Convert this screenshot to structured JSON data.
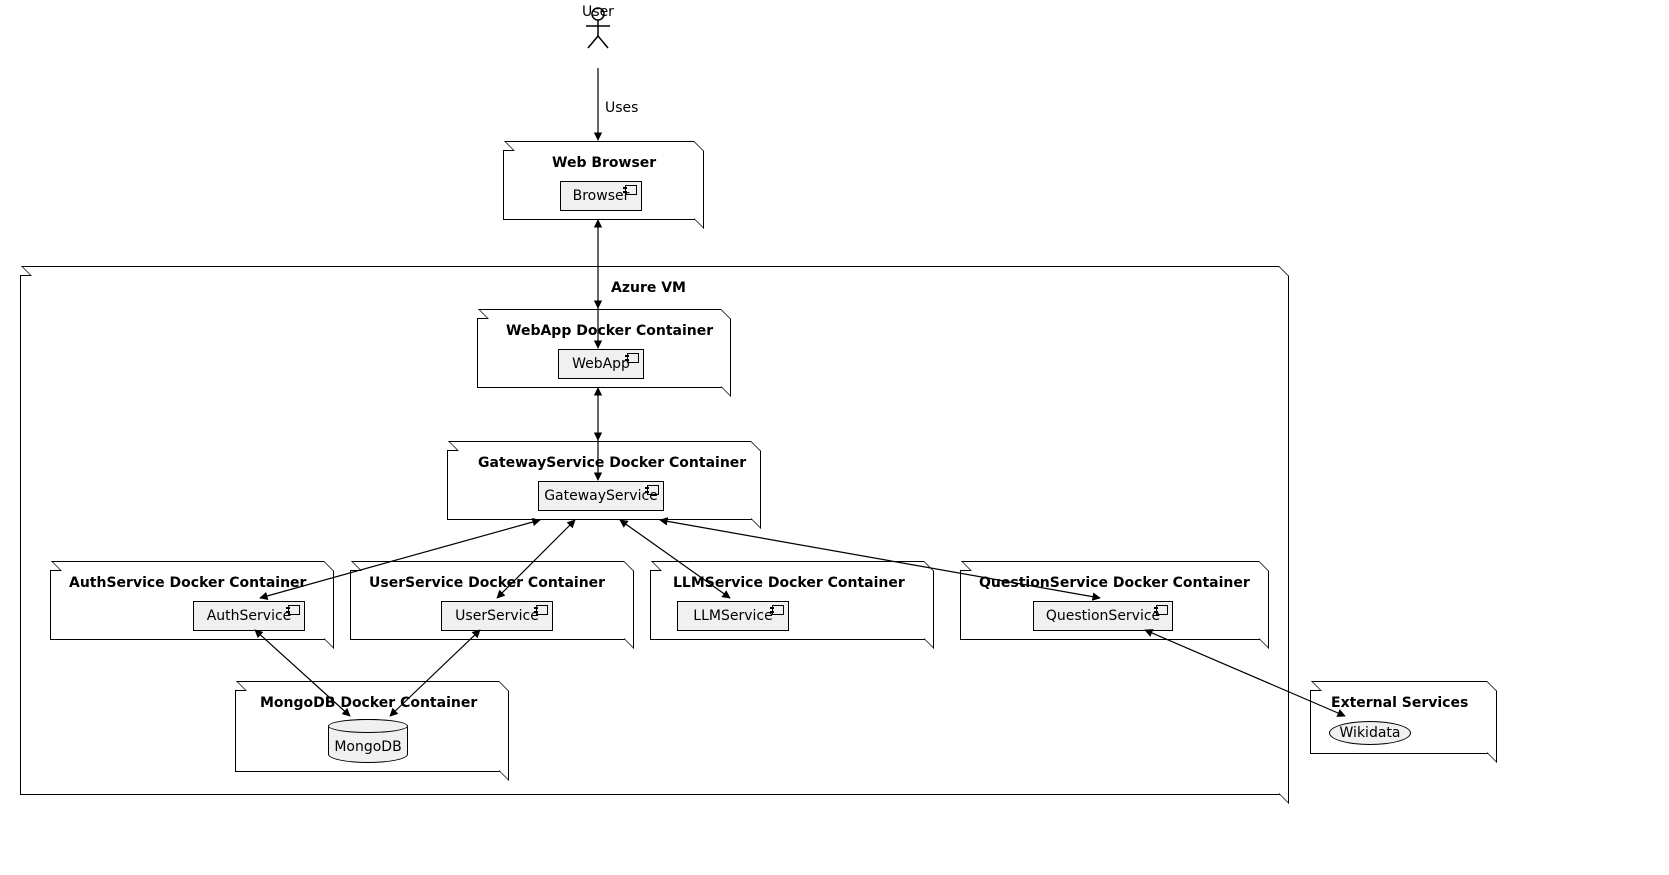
{
  "actor": {
    "name": "User"
  },
  "edge_labels": {
    "uses": "Uses"
  },
  "nodes": {
    "webbrowser": {
      "title": "Web Browser",
      "component": "Browser"
    },
    "azure": {
      "title": "Azure VM"
    },
    "webapp": {
      "title": "WebApp Docker Container",
      "component": "WebApp"
    },
    "gateway": {
      "title": "GatewayService Docker Container",
      "component": "GatewayService"
    },
    "auth": {
      "title": "AuthService Docker Container",
      "component": "AuthService"
    },
    "user": {
      "title": "UserService Docker Container",
      "component": "UserService"
    },
    "llm": {
      "title": "LLMService Docker Container",
      "component": "LLMService"
    },
    "question": {
      "title": "QuestionService Docker Container",
      "component": "QuestionService"
    },
    "mongo": {
      "title": "MongoDB Docker Container",
      "database": "MongoDB"
    },
    "external": {
      "title": "External Services",
      "service": "Wikidata"
    }
  }
}
